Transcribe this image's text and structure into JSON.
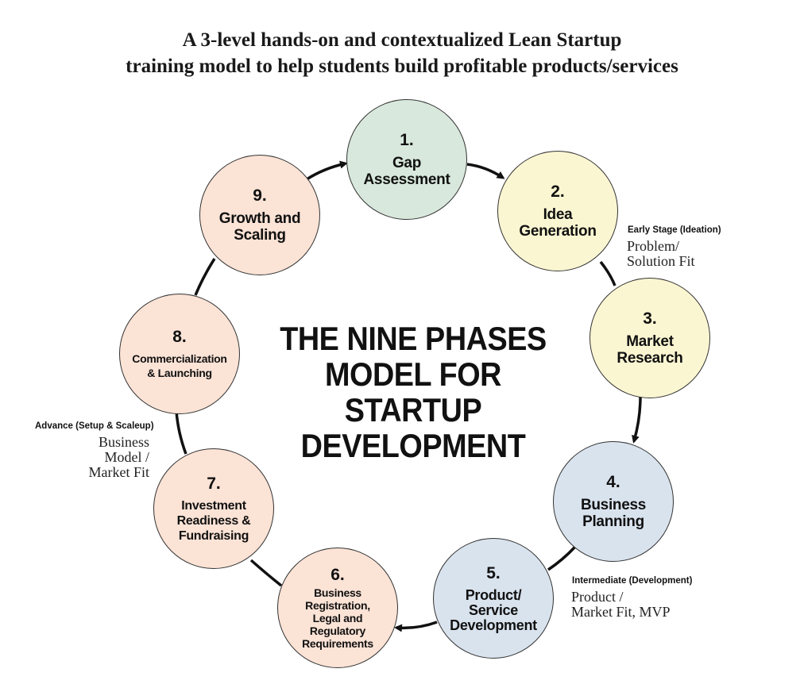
{
  "title": {
    "line1": "A 3-level hands-on and contextualized Lean Startup",
    "line2": "training model to help students build profitable products/services"
  },
  "center_title": [
    "THE NINE PHASES",
    "MODEL FOR",
    "STARTUP",
    "DEVELOPMENT"
  ],
  "phases": [
    {
      "num": "1.",
      "lines": [
        "Gap",
        "Assessment"
      ],
      "color": "#d8e8dc"
    },
    {
      "num": "2.",
      "lines": [
        "Idea",
        "Generation"
      ],
      "color": "#fbf6d2"
    },
    {
      "num": "3.",
      "lines": [
        "Market",
        "Research"
      ],
      "color": "#fbf6d2"
    },
    {
      "num": "4.",
      "lines": [
        "Business",
        "Planning"
      ],
      "color": "#d9e3ee"
    },
    {
      "num": "5.",
      "lines": [
        "Product/",
        "Service",
        "Development"
      ],
      "color": "#d9e3ee"
    },
    {
      "num": "6.",
      "lines": [
        "Business",
        "Registration,",
        "Legal and",
        "Regulatory",
        "Requirements"
      ],
      "color": "#fbe3d6"
    },
    {
      "num": "7.",
      "lines": [
        "Investment",
        "Readiness &",
        "Fundraising"
      ],
      "color": "#fbe3d6"
    },
    {
      "num": "8.",
      "lines": [
        "Commercialization",
        "& Launching"
      ],
      "color": "#fbe3d6"
    },
    {
      "num": "9.",
      "lines": [
        "Growth and",
        "Scaling"
      ],
      "color": "#fbe3d6"
    }
  ],
  "stages": {
    "early": {
      "label": "Early Stage (Ideation)",
      "sub": [
        "Problem/",
        "Solution Fit"
      ]
    },
    "intermediate": {
      "label": "Intermediate (Development)",
      "sub": [
        "Product /",
        "Market Fit, MVP"
      ]
    },
    "advance": {
      "label": "Advance (Setup & Scaleup)",
      "sub": [
        "Business",
        "Model /",
        "Market Fit"
      ]
    }
  }
}
